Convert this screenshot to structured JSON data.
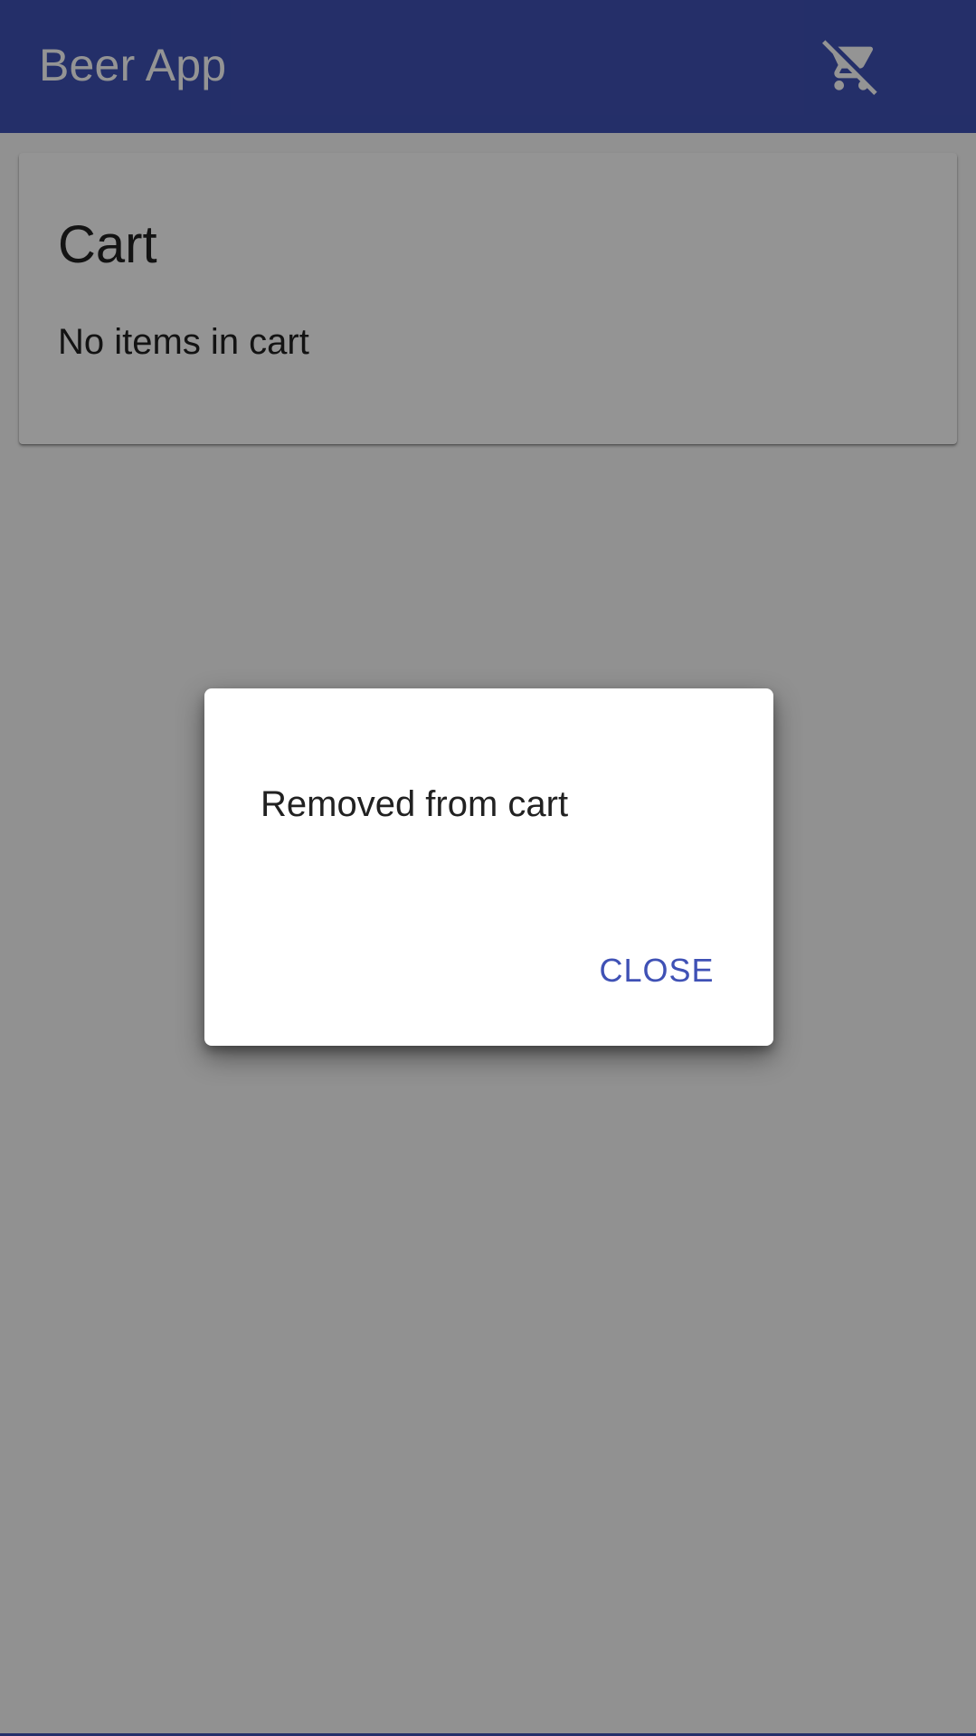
{
  "app_bar": {
    "title": "Beer App",
    "cart_icon": "remove-shopping-cart-icon",
    "color": "#3f51b5"
  },
  "cart_card": {
    "title": "Cart",
    "empty_message": "No items in cart"
  },
  "dialog": {
    "message": "Removed from cart",
    "close_label": "CLOSE",
    "accent_color": "#3f51b5"
  }
}
